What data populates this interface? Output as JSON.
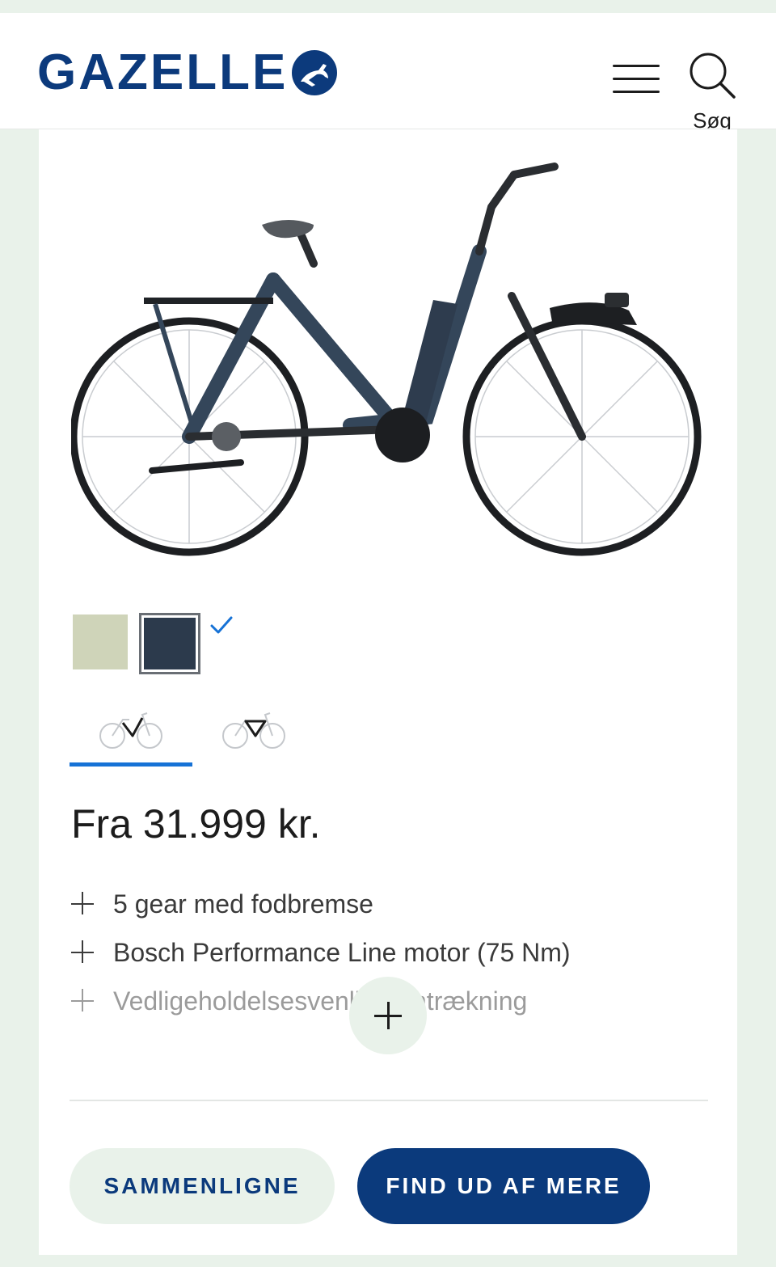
{
  "header": {
    "logo_text": "GAZELLE",
    "menu_icon": "hamburger-menu-icon",
    "search_icon": "search-icon",
    "search_label": "Søg"
  },
  "product": {
    "image": "e-bike-product-image",
    "colors": [
      {
        "name": "sage",
        "hex": "#cfd4b9",
        "selected": false
      },
      {
        "name": "dark-blue",
        "hex": "#2c3a4c",
        "selected": true
      }
    ],
    "frame_types": [
      {
        "icon": "low-step-frame-bike-icon",
        "selected": true
      },
      {
        "icon": "diamond-frame-bike-icon",
        "selected": false
      }
    ],
    "price": "Fra 31.999 kr.",
    "features": [
      "5 gear med fodbremse",
      "Bosch Performance Line motor (75 Nm)",
      "Vedligeholdelsesvenlig remtrækning"
    ]
  },
  "actions": {
    "compare_label": "SAMMENLIGNE",
    "more_label": "FIND UD AF MERE"
  },
  "colors": {
    "brand": "#0b3a7c",
    "accent": "#1672d6",
    "background": "#e9f2ea"
  }
}
